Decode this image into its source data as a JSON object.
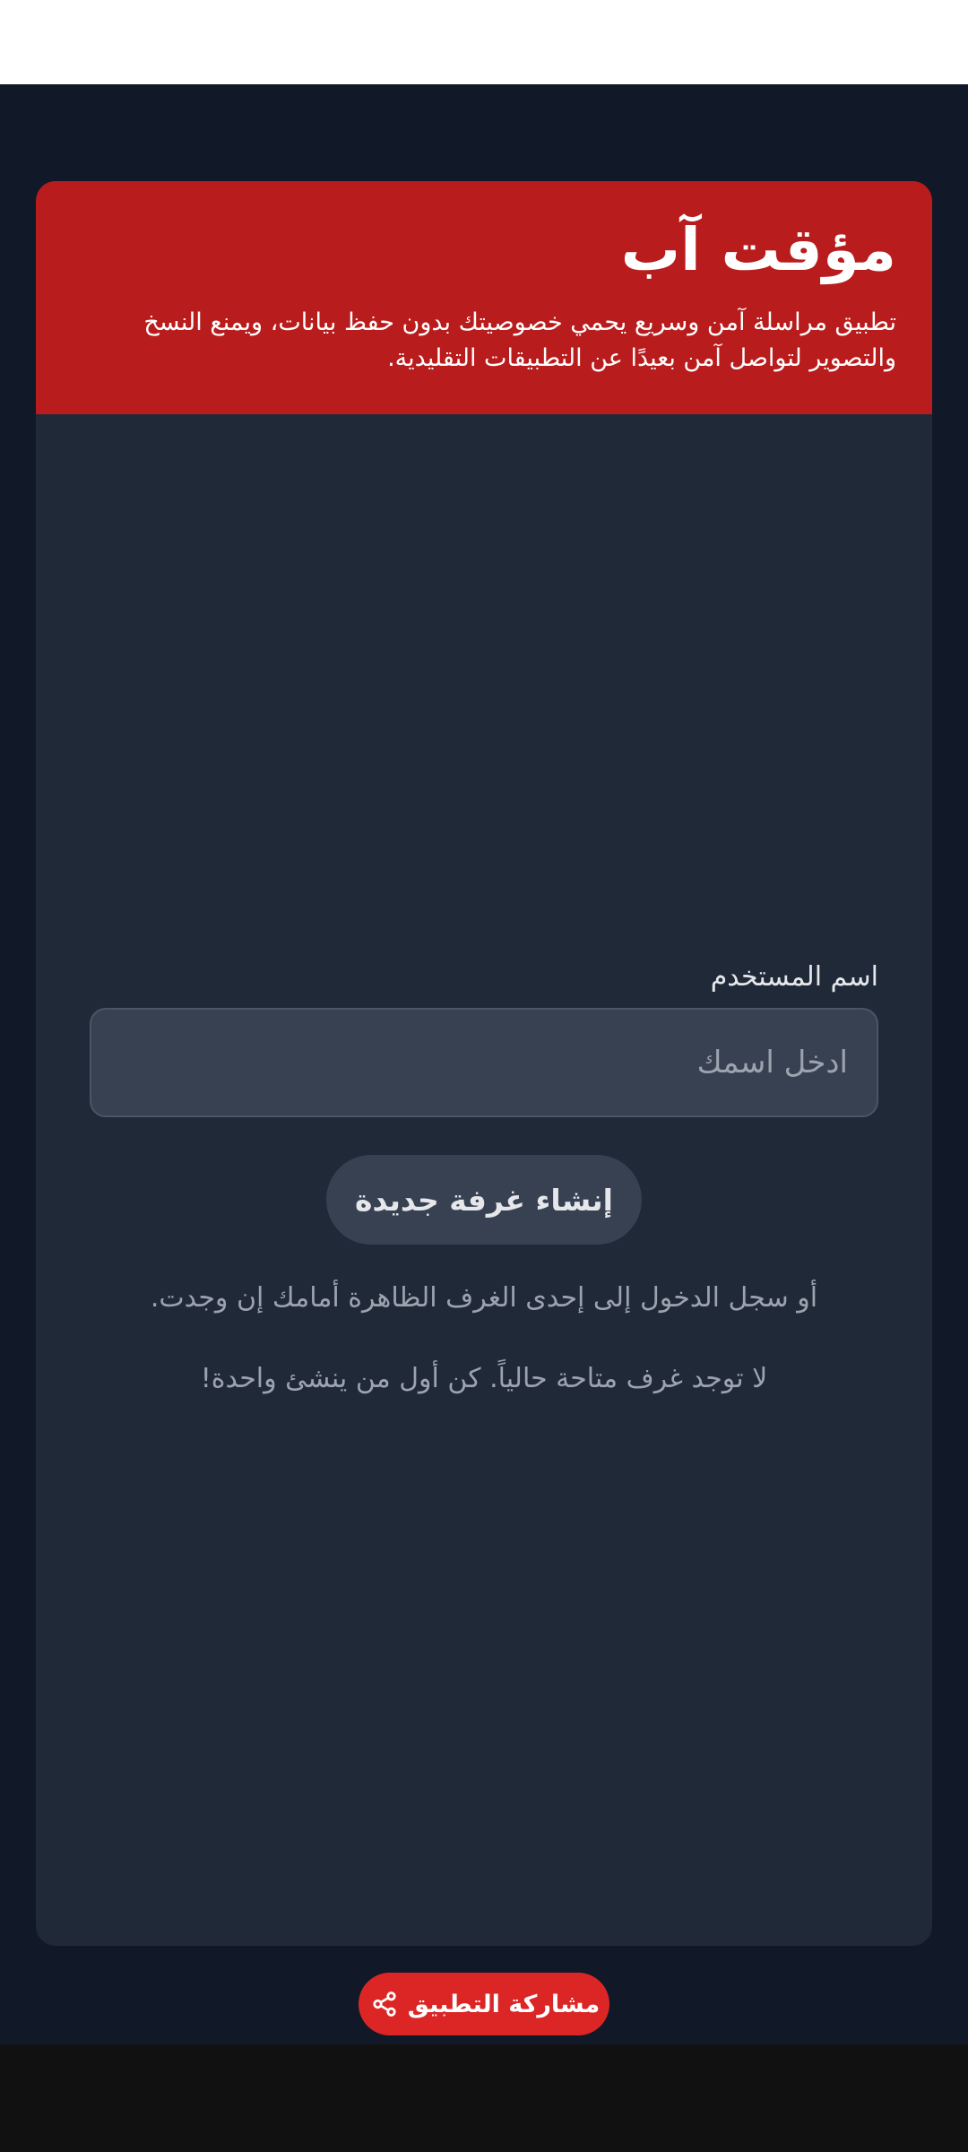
{
  "app": {
    "title": "مؤقت آب",
    "description": "تطبيق مراسلة آمن وسريع يحمي خصوصيتك بدون حفظ بيانات، ويمنع النسخ والتصوير لتواصل آمن بعيدًا عن التطبيقات التقليدية."
  },
  "login": {
    "username_label": "اسم المستخدم",
    "username_placeholder": "ادخل اسمك",
    "username_value": "",
    "create_room_label": "إنشاء غرفة جديدة",
    "join_hint": "أو سجل الدخول إلى إحدى الغرف الظاهرة أمامك إن وجدت.",
    "no_rooms": "لا توجد غرف متاحة حالياً. كن أول من ينشئ واحدة!"
  },
  "share": {
    "label": "مشاركة التطبيق",
    "icon": "share-icon"
  },
  "colors": {
    "page_background": "#111827",
    "card_background": "#1f2937",
    "header_background": "#b91c1c",
    "input_background": "#374151",
    "share_button": "#dc2626"
  }
}
